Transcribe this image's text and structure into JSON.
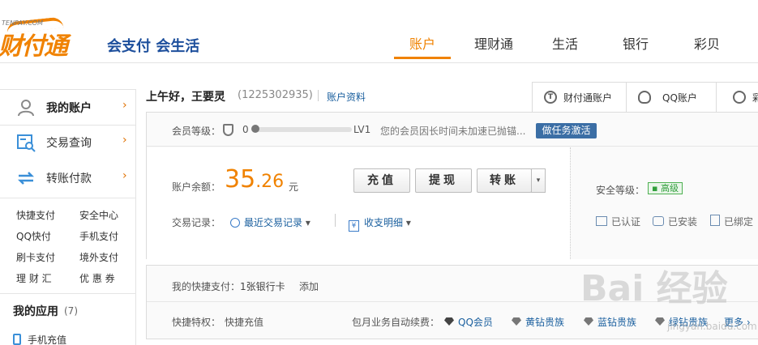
{
  "header": {
    "logo_small": "TENPAY.COM",
    "logo_main": "财付通",
    "slogan": "会支付 会生活",
    "nav": [
      "账户",
      "理财通",
      "生活",
      "银行",
      "彩贝"
    ],
    "active_nav": "账户",
    "accent_color": "#f08200"
  },
  "sidebar": {
    "main_items": [
      {
        "label": "我的账户",
        "icon": "user-icon",
        "active": true
      },
      {
        "label": "交易查询",
        "icon": "search-list-icon",
        "active": false
      },
      {
        "label": "转账付款",
        "icon": "transfer-icon",
        "active": false
      }
    ],
    "arrow": "›",
    "quick_links": [
      [
        "快捷支付",
        "安全中心"
      ],
      [
        "QQ快付",
        "手机支付"
      ],
      [
        "刷卡支付",
        "境外支付"
      ],
      [
        "理 财 汇",
        "优 惠 券"
      ]
    ],
    "apps_title": "我的应用",
    "apps_count": "(7)",
    "apps": [
      "手机充值"
    ]
  },
  "account": {
    "greeting": "上午好，王要灵",
    "qq_number": "(1225302935)",
    "profile_link": "账户资料",
    "tabs": [
      {
        "label": "财付通账户",
        "icon": "tenpay-icon"
      },
      {
        "label": "QQ账户",
        "icon": "qq-icon"
      },
      {
        "label": "彩",
        "icon": "caibei-icon"
      }
    ]
  },
  "member": {
    "label": "会员等级：",
    "level_start": "0",
    "level_end": "LV1",
    "progress": 0,
    "notice": "您的会员因长时间未加速已抛锚...",
    "task_button": "做任务激活"
  },
  "balance": {
    "label": "账户余额：",
    "integer": "35",
    "decimal": ".26",
    "unit": "元",
    "buttons": [
      "充值",
      "提现",
      "转账"
    ],
    "records_label": "交易记录：",
    "recent_records": "最近交易记录",
    "income_detail": "收支明细",
    "dropdown_caret": "▾"
  },
  "security": {
    "label": "安全等级：",
    "level": "高级",
    "items": [
      "已认证",
      "已安装",
      "已绑定"
    ],
    "status_color": "#2f9e3a"
  },
  "quickpay": {
    "label": "我的快捷支付：",
    "value": "1张银行卡",
    "add": "添加",
    "privilege_label": "快捷特权：",
    "privilege_link": "快捷充值",
    "monthly_label": "包月业务自动续费：",
    "vip_items": [
      "QQ会员",
      "黄钻贵族",
      "蓝钻贵族",
      "绿钻贵族"
    ],
    "more": "更多"
  },
  "watermark": {
    "text": "Bai 经验",
    "url": "jingyan.baidu.com"
  }
}
